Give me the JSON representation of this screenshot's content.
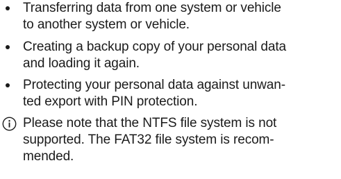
{
  "bullets": [
    {
      "text": "Transferring data from one system or vehicle\nto another system or vehicle."
    },
    {
      "text": "Creating a backup copy of your personal data\nand loading it again."
    },
    {
      "text": "Protecting your personal data against unwan-\nted export with PIN protection."
    }
  ],
  "note": {
    "icon": "info-icon",
    "text": "Please note that the NTFS file system is not\nsupported. The FAT32 file system is recom-\nmended."
  },
  "colors": {
    "text": "#1a1a1a",
    "background": "#ffffff"
  }
}
